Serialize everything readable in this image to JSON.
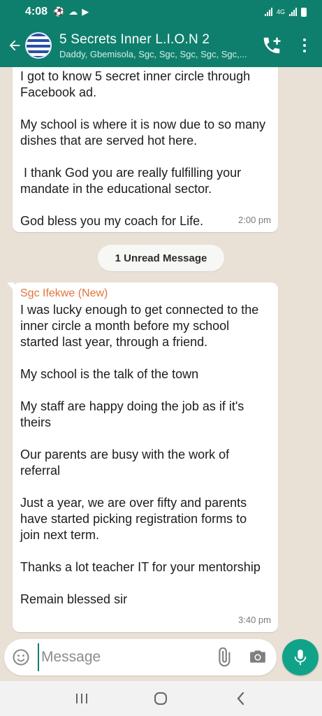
{
  "status_bar": {
    "time": "4:08",
    "network_label": "4G"
  },
  "header": {
    "title": "5 Secrets Inner L.I.O.N 2",
    "subtitle": "Daddy, Gbemisola, Sgc, Sgc, Sgc, Sgc, Sgc,..."
  },
  "messages": [
    {
      "paragraphs": [
        "I got to know 5 secret inner circle through Facebook ad.",
        "My school is where it is now due to so many dishes that are served hot here.",
        " I thank God you are really fulfilling your mandate in the educational sector.",
        "God bless you my coach for Life."
      ],
      "time": "2:00 pm"
    },
    {
      "sender": "Sgc Ifekwe (New)",
      "paragraphs": [
        "I was lucky enough to get connected to the inner circle a month before my school started last year, through a friend.",
        "My school is the talk of the town",
        "My staff are happy doing the job as if it's theirs",
        "Our parents are busy with the work of referral",
        "Just a year, we are over fifty and parents have started picking registration forms to join next term.",
        "Thanks a lot teacher IT for your mentorship",
        "Remain blessed sir"
      ],
      "time": "3:40 pm"
    }
  ],
  "unread_label": "1 Unread Message",
  "composer": {
    "placeholder": "Message"
  },
  "colors": {
    "primary": "#0f7f6d",
    "accent": "#11a38a",
    "sender": "#e0743b"
  }
}
